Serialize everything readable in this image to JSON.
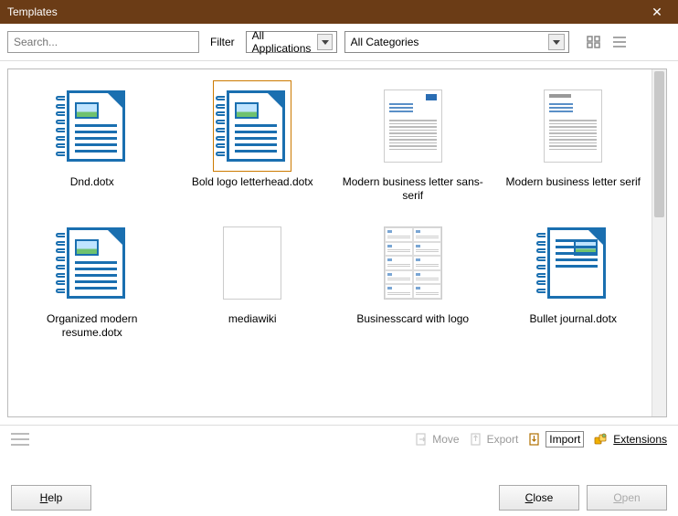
{
  "titlebar": {
    "title": "Templates",
    "close": "✕"
  },
  "toolbar": {
    "search_placeholder": "Search...",
    "filter_label": "Filter",
    "app_combo": "All Applications",
    "cat_combo": "All Categories"
  },
  "templates": [
    {
      "name": "Dnd.dotx",
      "kind": "doc"
    },
    {
      "name": "Bold logo letterhead.dotx",
      "kind": "doc",
      "selected": true
    },
    {
      "name": "Modern business letter sans-serif",
      "kind": "letter_sans"
    },
    {
      "name": "Modern business letter serif",
      "kind": "letter_serif"
    },
    {
      "name": "Organized modern resume.dotx",
      "kind": "doc"
    },
    {
      "name": "mediawiki",
      "kind": "blank"
    },
    {
      "name": "Businesscard with logo",
      "kind": "bcard"
    },
    {
      "name": "Bullet journal.dotx",
      "kind": "doc_bullet"
    }
  ],
  "actions": {
    "move": "Move",
    "export": "Export",
    "import": "Import",
    "extensions": "Extensions"
  },
  "buttons": {
    "help": "elp",
    "help_u": "H",
    "close": "lose",
    "close_u": "C",
    "open": "pen",
    "open_u": "O"
  }
}
